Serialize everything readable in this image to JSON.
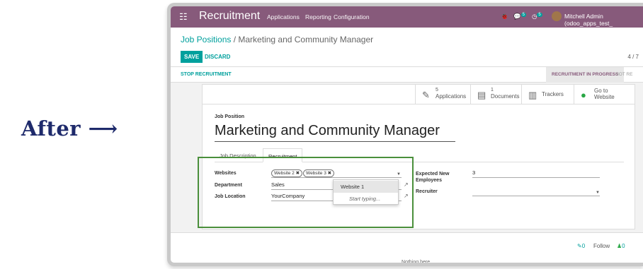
{
  "annotation": {
    "label": "After ⟶"
  },
  "navbar": {
    "app_name": "Recruitment",
    "menu": [
      "Applications",
      "Reporting",
      "Configuration"
    ],
    "chat_count": "5",
    "activity_count": "5",
    "user": "Mitchell Admin (odoo_apps_test_"
  },
  "breadcrumb": {
    "parent": "Job Positions",
    "sep": " / ",
    "current": "Marketing and Community Manager"
  },
  "toolbar": {
    "save_label": "SAVE",
    "discard_label": "DISCARD",
    "pager": "4 / 7"
  },
  "status": {
    "stop_label": "STOP RECRUITMENT",
    "active_stage": "RECRUITMENT IN PROGRESS",
    "next_stage": "NOT RE"
  },
  "stats": {
    "applications": {
      "count": "5",
      "label": "Applications"
    },
    "documents": {
      "count": "1",
      "label": "Documents"
    },
    "trackers": {
      "label": "Trackers"
    },
    "website": {
      "line1": "Go to",
      "line2": "Website"
    }
  },
  "form": {
    "position_label": "Job Position",
    "position_name": "Marketing and Community Manager",
    "tabs": [
      "Job Description",
      "Recruitment"
    ],
    "websites_label": "Websites",
    "websites_tags": [
      "Website 2 ✖",
      "Website 3 ✖"
    ],
    "department_label": "Department",
    "department_value": "Sales",
    "location_label": "Job Location",
    "location_value": "YourCompany",
    "expected_label_1": "Expected New",
    "expected_label_2": "Employees",
    "expected_value": "3",
    "recruiter_label": "Recruiter",
    "recruiter_value": ""
  },
  "dropdown": {
    "option": "Website 1",
    "typing": "Start typing..."
  },
  "chatter": {
    "followers_count": "0",
    "follow_label": "Follow",
    "members_count": "0",
    "partial_text": "Nothing here"
  },
  "colors": {
    "brand": "#875a7b",
    "accent": "#00a09d",
    "highlight_box": "#4a8f3b"
  }
}
